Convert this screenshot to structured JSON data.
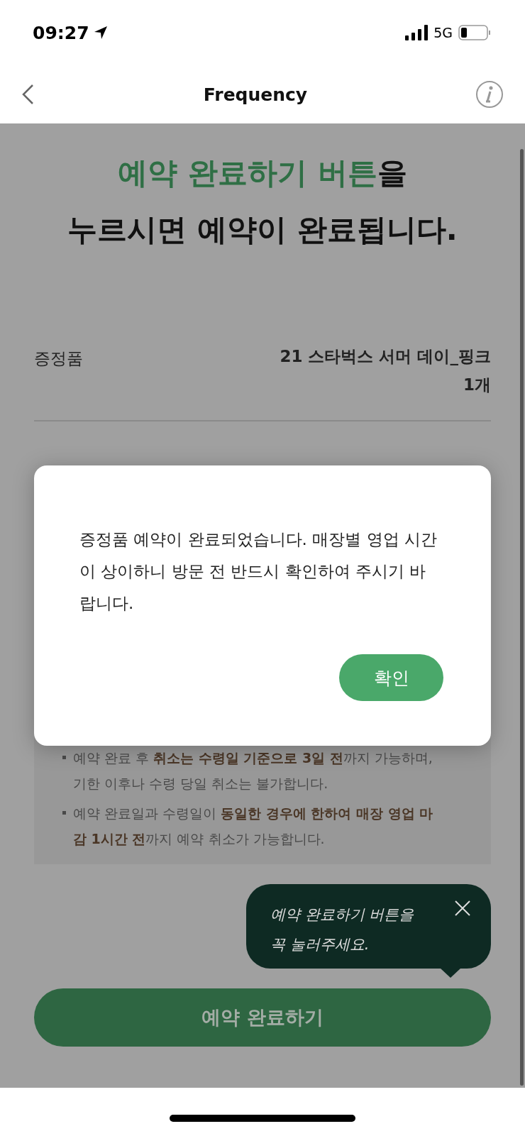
{
  "status_bar": {
    "time": "09:27",
    "network": "5G"
  },
  "nav": {
    "title": "Frequency"
  },
  "headline": {
    "highlight": "예약 완료하기 버튼",
    "rest": "을",
    "line2": "누르시면 예약이 완료됩니다."
  },
  "details": [
    {
      "label": "증정품",
      "value_lines": [
        "21 스타벅스 서머 데이_핑크",
        "1개"
      ]
    }
  ],
  "notes": [
    {
      "text": "예약 완료 후 **취소는 수령일 기준으로 3일 전**까지 가능하며, 기한 이후나 수령 당일 취소는 불가합니다."
    },
    {
      "text": "예약 완료일과 수령일이 **동일한 경우에 한하여 매장 영업 마감 1시간 전**까지 예약 취소가 가능합니다."
    }
  ],
  "tooltip": {
    "text": "예약 완료하기 버튼을 꼭 눌러주세요."
  },
  "cta": {
    "label": "예약 완료하기"
  },
  "modal": {
    "message": "증정품 예약이 완료되었습니다. 매장별 영업 시간이 상이하니 방문 전 반드시 확인하여 주시기 바랍니다.",
    "confirm": "확인"
  }
}
